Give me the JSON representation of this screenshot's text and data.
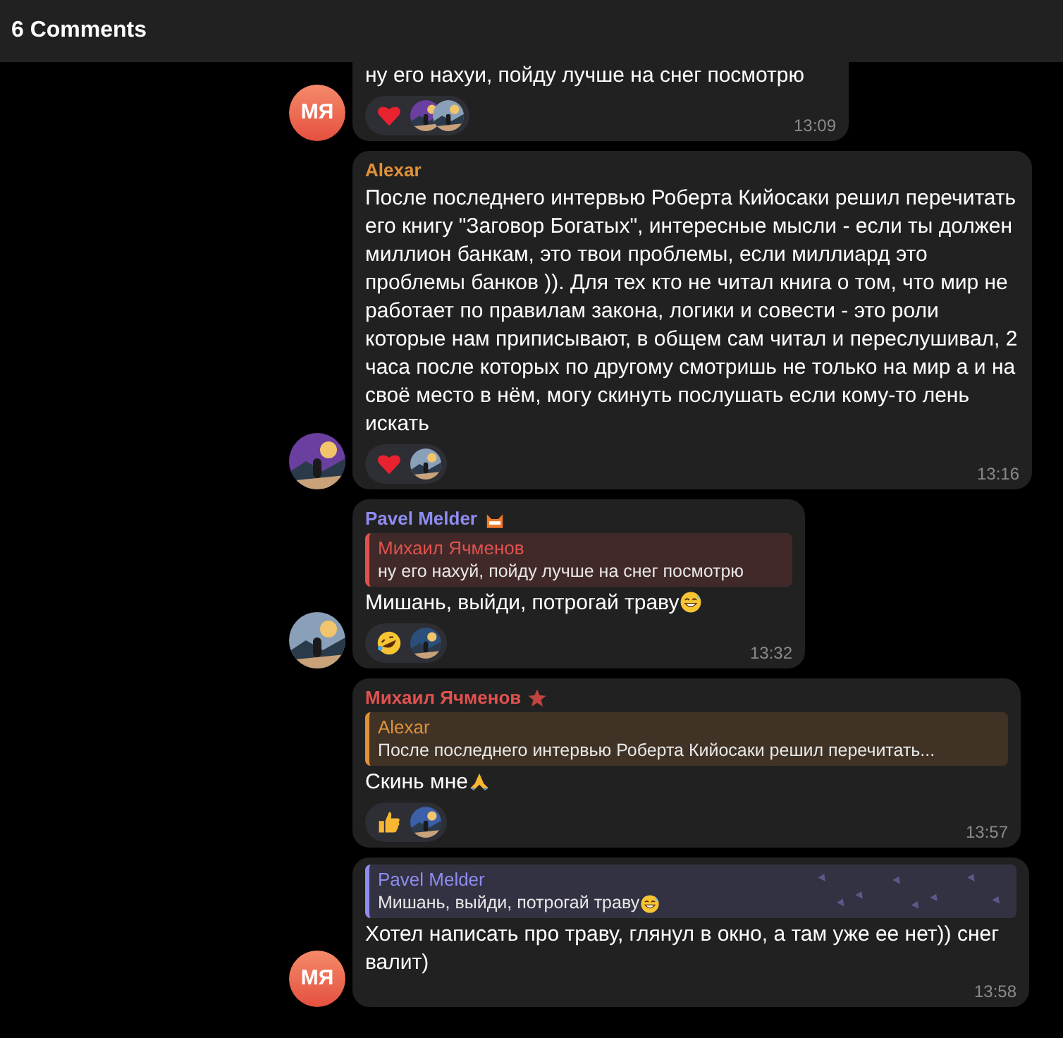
{
  "header": {
    "title": "6 Comments"
  },
  "messages": [
    {
      "avatar": {
        "kind": "initials",
        "text": "МЯ"
      },
      "text": "ну его нахуи, пойду лучше на снег посмотрю",
      "reactions": [
        {
          "kind": "heart",
          "reactors": [
            {
              "kind": "picture"
            },
            {
              "kind": "picture"
            }
          ]
        }
      ],
      "time": "13:09"
    },
    {
      "avatar": {
        "kind": "picture"
      },
      "author": {
        "name": "Alexar",
        "color": "#e0913a"
      },
      "text": "После последнего интервью Роберта Кийосаки решил перечитать его книгу \"Заговор Богатых\", интересные мысли - если ты должен миллион банкам, это твои проблемы, если миллиард это проблемы банков )). Для тех кто не читал книга о том, что мир не работает по правилам закона, логики и совести - это роли которые нам приписывают, в общем сам читал и переслушивал, 2 часа после которых по другому смотришь не только на мир а и на своё место в нём, могу скинуть послушать если кому-то лень искать",
      "reactions": [
        {
          "kind": "heart",
          "reactors": [
            {
              "kind": "picture"
            }
          ]
        }
      ],
      "time": "13:16"
    },
    {
      "avatar": {
        "kind": "picture"
      },
      "author": {
        "name": "Pavel Melder",
        "color": "#8f8cf0",
        "badge": {
          "kind": "cat"
        }
      },
      "reply": {
        "name": "Михаил Ячменов",
        "color": "#e0524f",
        "text": "ну его нахуй, пойду лучше на снег посмотрю"
      },
      "text": "Мишань, выйди, потрогай траву",
      "emoji": {
        "kind": "sweat_smile"
      },
      "reactions": [
        {
          "kind": "rofl",
          "reactors": [
            {
              "kind": "picture"
            }
          ]
        }
      ],
      "time": "13:32"
    },
    {
      "avatar": {
        "kind": "none"
      },
      "author": {
        "name": "Михаил Ячменов",
        "color": "#e0524f",
        "badge": {
          "kind": "star"
        }
      },
      "reply": {
        "name": "Alexar",
        "color": "#e0913a",
        "text": "После последнего интервью Роберта Кийосаки решил перечитать..."
      },
      "text": "Скинь мне",
      "emoji": {
        "kind": "pray"
      },
      "reactions": [
        {
          "kind": "thumbs_up",
          "reactors": [
            {
              "kind": "picture"
            }
          ]
        }
      ],
      "time": "13:57"
    },
    {
      "avatar": {
        "kind": "initials",
        "text": "МЯ"
      },
      "reply": {
        "name": "Pavel Melder",
        "color": "#8f8cf0",
        "text": "Мишань, выйди, потрогай траву",
        "emoji": {
          "kind": "sweat_smile"
        },
        "pattern": true
      },
      "text": "Хотел написать про траву, глянул в окно, а там уже ее нет)) снег валит)",
      "time": "13:58"
    }
  ]
}
